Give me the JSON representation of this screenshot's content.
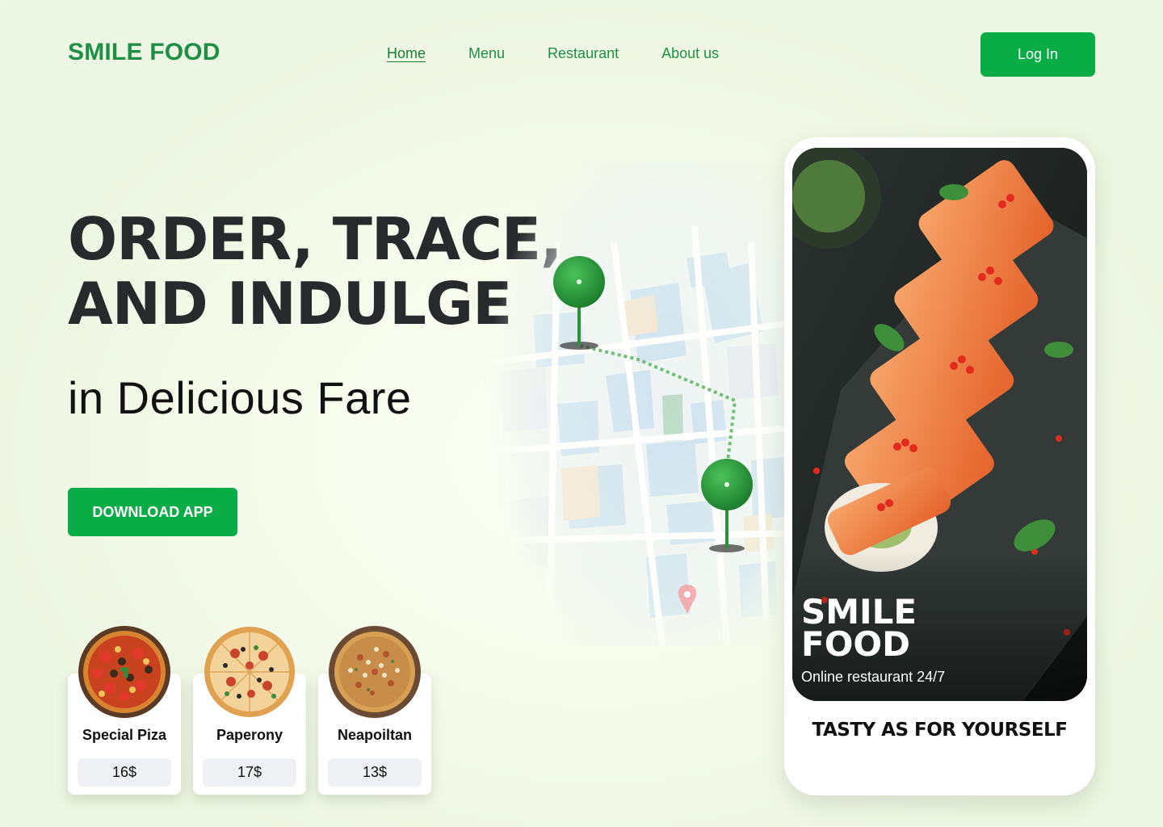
{
  "brand": {
    "logo_text": "SMILE FOOD"
  },
  "nav": {
    "items": [
      {
        "label": "Home",
        "active": true
      },
      {
        "label": "Menu"
      },
      {
        "label": "Restaurant"
      },
      {
        "label": "About us"
      }
    ]
  },
  "header": {
    "login_label": "Log In"
  },
  "hero": {
    "title_line1": "ORDER, TRACE,",
    "title_line2": "AND INDULGE",
    "subtitle": "in Delicious Fare",
    "cta_label": "DOWNLOAD APP"
  },
  "pizzas": [
    {
      "name": "Special Piza",
      "price": "16$"
    },
    {
      "name": "Paperony",
      "price": "17$"
    },
    {
      "name": "Neapoiltan",
      "price": "13$"
    }
  ],
  "phone": {
    "brand_line1": "SMILE",
    "brand_line2": "FOOD",
    "tagline": "Online restaurant 24/7",
    "caption": "TASTY AS FOR YOURSELF"
  },
  "colors": {
    "accent": "#0aac46",
    "brand_text": "#1f8f48",
    "heading": "#272a2b"
  },
  "icons": [
    "map-pin-icon",
    "location-marker-icon"
  ]
}
